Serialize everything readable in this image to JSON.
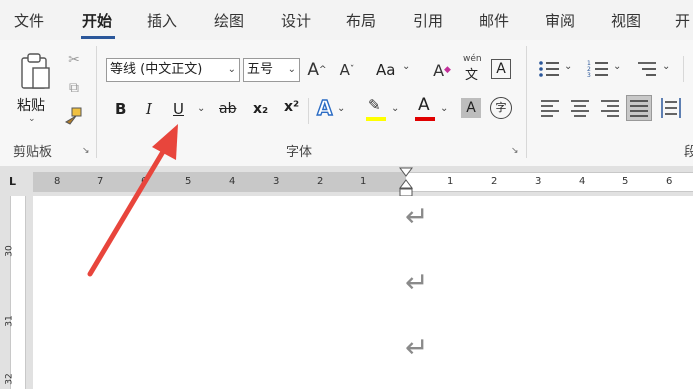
{
  "tabs": [
    "文件",
    "开始",
    "插入",
    "绘图",
    "设计",
    "布局",
    "引用",
    "邮件",
    "审阅",
    "视图",
    "开"
  ],
  "clipboard": {
    "paste_label": "粘贴",
    "group_label": "剪贴板"
  },
  "font": {
    "font_name": "等线 (中文正文)",
    "font_size": "五号",
    "change_case": "Aa",
    "phonetic_guide": "wén",
    "phonetic_char": "文",
    "char_border": "A",
    "bold": "B",
    "italic": "I",
    "underline": "U",
    "strikethrough": "ab",
    "subscript": "x₂",
    "superscript": "x²",
    "text_effects": "A",
    "font_color": "A",
    "char_shading": "A",
    "enclose_char": "字",
    "group_label": "字体"
  },
  "paragraph": {
    "group_label": "段"
  },
  "ruler": {
    "left_numbers": [
      "8",
      "7",
      "6",
      "5",
      "4",
      "3",
      "2",
      "1"
    ],
    "right_numbers": [
      "1",
      "2",
      "3",
      "4",
      "5",
      "6",
      "7"
    ]
  },
  "vertical_ruler": {
    "numbers": [
      "30",
      "31",
      "32"
    ]
  },
  "document": {
    "paragraph_marks": [
      "↵",
      "↵",
      "↵"
    ]
  },
  "colors": {
    "accent": "#2b579a",
    "highlight": "#ffff00",
    "font_color_bar": "#e00000",
    "arrow": "#e8453c"
  }
}
